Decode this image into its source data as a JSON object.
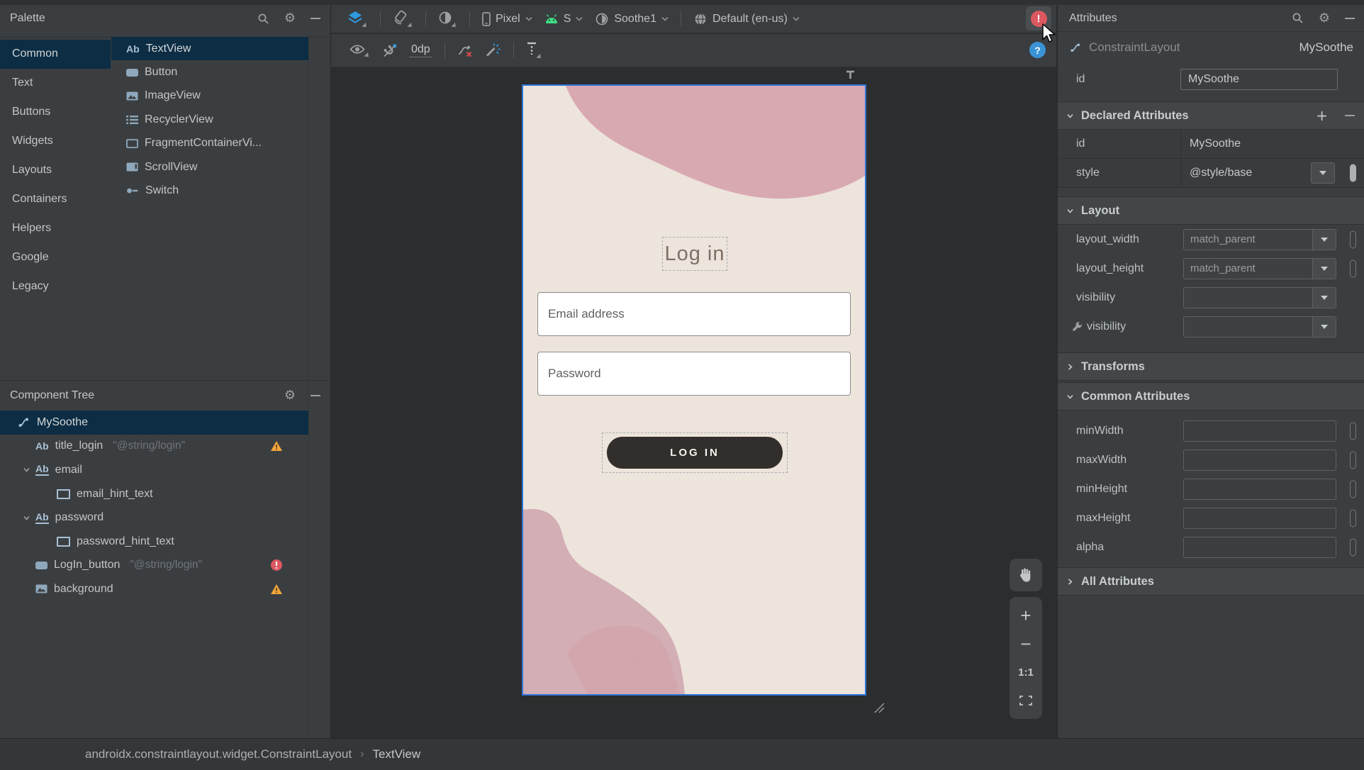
{
  "window": {
    "palette_title": "Palette",
    "component_tree_title": "Component Tree",
    "attributes_title": "Attributes"
  },
  "palette": {
    "categories": [
      "Common",
      "Text",
      "Buttons",
      "Widgets",
      "Layouts",
      "Containers",
      "Helpers",
      "Google",
      "Legacy"
    ],
    "selected_category": "Common",
    "items": [
      {
        "label": "TextView",
        "selected": true
      },
      {
        "label": "Button"
      },
      {
        "label": "ImageView"
      },
      {
        "label": "RecyclerView"
      },
      {
        "label": "FragmentContainerVi..."
      },
      {
        "label": "ScrollView"
      },
      {
        "label": "Switch"
      }
    ]
  },
  "tree": {
    "nodes": [
      {
        "label": "MySoothe",
        "type": "constraint-layout",
        "selected": true
      },
      {
        "label": "title_login",
        "value": "\"@string/login\"",
        "badge": "warning"
      },
      {
        "label": "email",
        "expanded": true
      },
      {
        "label": "email_hint_text"
      },
      {
        "label": "password",
        "expanded": true
      },
      {
        "label": "password_hint_text"
      },
      {
        "label": "LogIn_button",
        "value": "\"@string/login\"",
        "badge": "error"
      },
      {
        "label": "background",
        "badge": "warning"
      }
    ]
  },
  "toolbar1": {
    "device": "Pixel",
    "api": "S",
    "theme": "Soothe1",
    "locale": "Default (en-us)"
  },
  "toolbar2": {
    "default_margin": "0dp"
  },
  "design": {
    "title": "Log in",
    "email_hint": "Email address",
    "password_hint": "Password",
    "login_button": "LOG IN",
    "colors": {
      "background": "#EDE4DC",
      "blob_top": "#D9A9B1",
      "blob_mauve": "#CFA6AE",
      "blob_coral": "#ECA3A5",
      "button": "#322E2B",
      "selection_border": "#2E75D8"
    }
  },
  "zoom": {
    "zoom_in": "+",
    "zoom_out": "−",
    "actual_size": "1:1"
  },
  "attrs": {
    "component_type": "ConstraintLayout",
    "component_id": "MySoothe",
    "id_label": "id",
    "id_value": "MySoothe",
    "declared_title": "Declared Attributes",
    "declared": [
      {
        "label": "id",
        "value": "MySoothe"
      },
      {
        "label": "style",
        "value": "@style/base"
      }
    ],
    "layout_title": "Layout",
    "layout": [
      {
        "label": "layout_width",
        "value": "match_parent"
      },
      {
        "label": "layout_height",
        "value": "match_parent"
      },
      {
        "label": "visibility",
        "value": ""
      },
      {
        "label": "visibility",
        "value": "",
        "tools": true
      }
    ],
    "transforms_title": "Transforms",
    "common_title": "Common Attributes",
    "common": [
      {
        "label": "minWidth"
      },
      {
        "label": "maxWidth"
      },
      {
        "label": "minHeight"
      },
      {
        "label": "maxHeight"
      },
      {
        "label": "alpha"
      }
    ],
    "all_title": "All Attributes"
  },
  "breadcrumb": {
    "root": "androidx.constraintlayout.widget.ConstraintLayout",
    "separator": "›",
    "leaf": "TextView"
  },
  "glyphs": {
    "ab": "Ab",
    "bang": "!",
    "question": "?",
    "gear": "⚙"
  }
}
